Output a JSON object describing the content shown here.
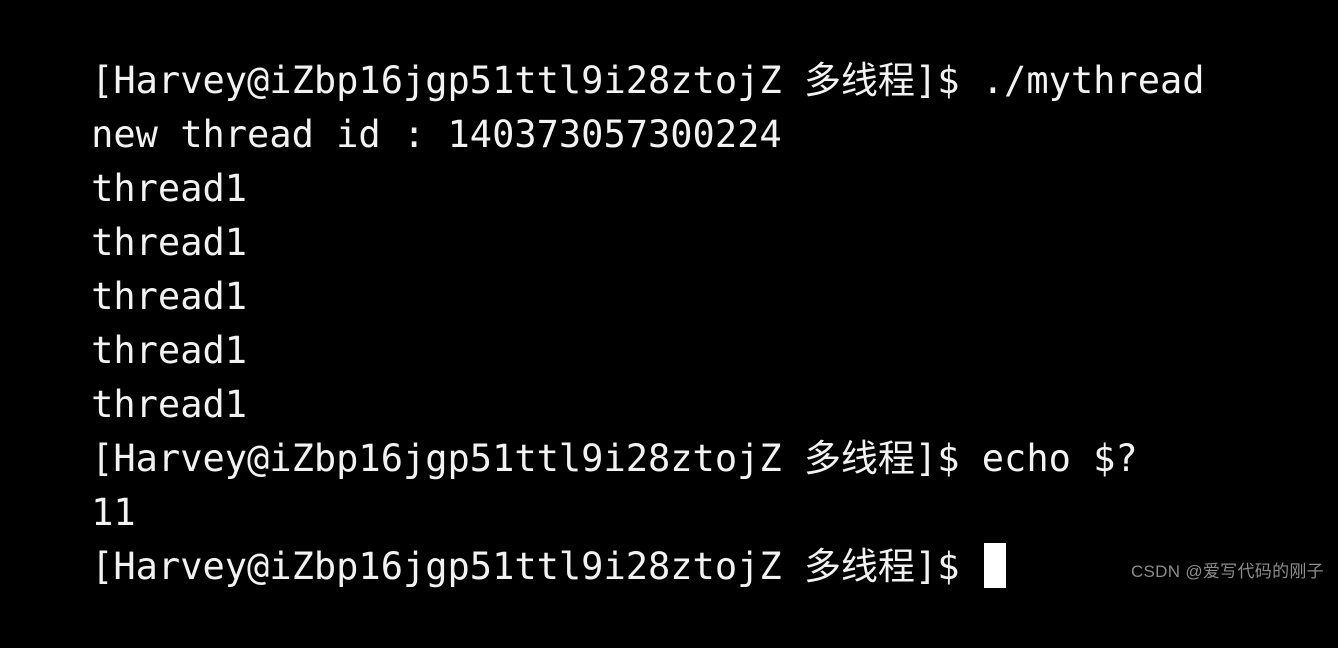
{
  "terminal": {
    "background_color": "#000000",
    "foreground_color": "#f2f2f2",
    "cursor_color": "#ffffff",
    "prompt": "[Harvey@iZbp16jgp51ttl9i28ztojZ 多线程]$ ",
    "lines": [
      {
        "type": "prompt",
        "prompt": "[Harvey@iZbp16jgp51ttl9i28ztojZ 多线程]$ ",
        "command": "./mythread"
      },
      {
        "type": "output",
        "text": "new thread id : 140373057300224"
      },
      {
        "type": "output",
        "text": "thread1"
      },
      {
        "type": "output",
        "text": "thread1"
      },
      {
        "type": "output",
        "text": "thread1"
      },
      {
        "type": "output",
        "text": "thread1"
      },
      {
        "type": "output",
        "text": "thread1"
      },
      {
        "type": "prompt",
        "prompt": "[Harvey@iZbp16jgp51ttl9i28ztojZ 多线程]$ ",
        "command": "echo $?"
      },
      {
        "type": "output",
        "text": "11"
      },
      {
        "type": "prompt_cursor",
        "prompt": "[Harvey@iZbp16jgp51ttl9i28ztojZ 多线程]$ ",
        "command": ""
      }
    ]
  },
  "watermark": {
    "text": "CSDN @爱写代码的刚子",
    "color": "#8c8c8c"
  }
}
